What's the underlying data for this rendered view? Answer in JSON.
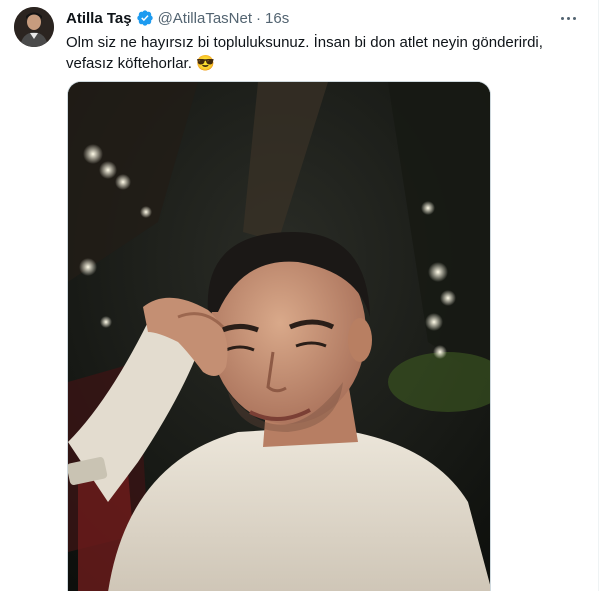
{
  "tweet": {
    "author_name": "Atilla Taş",
    "handle": "@AtillaTasNet",
    "separator": "·",
    "time": "16s",
    "text": "Olm siz ne hayırsız bi topluluksunuz. İnsan bi don atlet neyin gönderirdi, vefasız köftehorlar. 😎",
    "verified": true,
    "media_description_icon": "photo",
    "colors": {
      "name": "#0f1419",
      "secondary": "#536471",
      "verified": "#1d9bf0",
      "border": "#cfd9de"
    }
  }
}
